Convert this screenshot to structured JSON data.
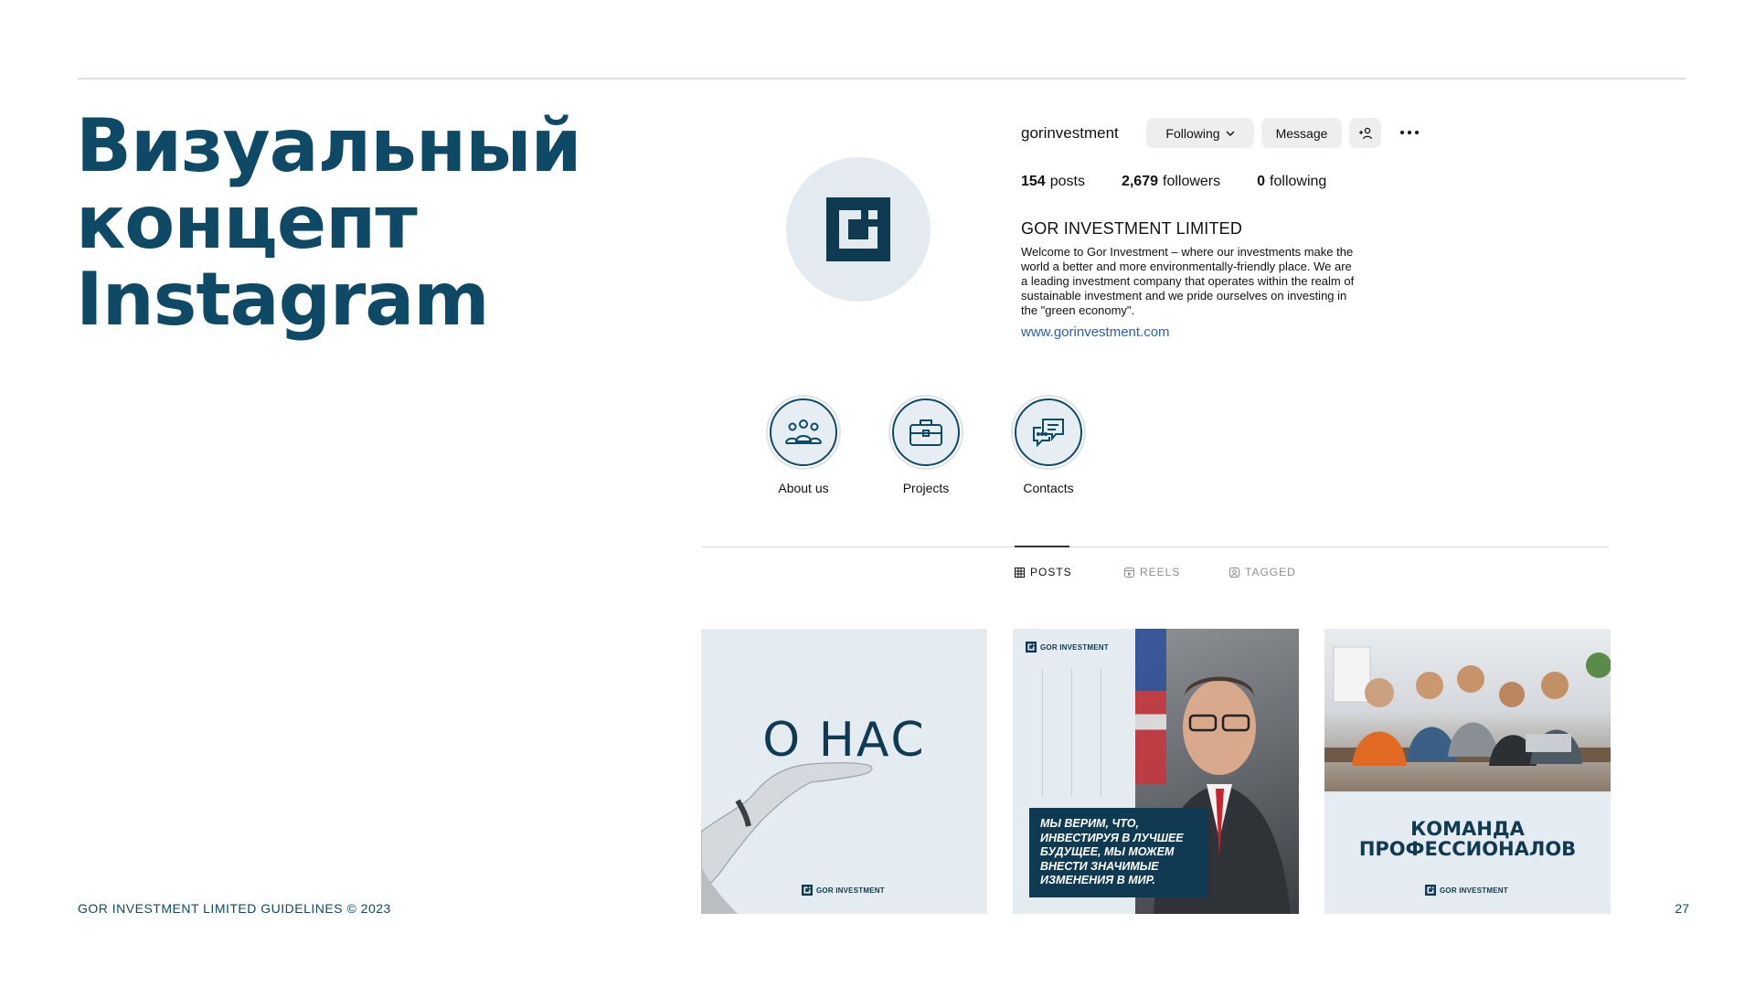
{
  "slide": {
    "title_lines": [
      "Визуальный",
      "концепт",
      "Instagram"
    ],
    "footer": "GOR INVESTMENT LIMITED GUIDELINES © 2023",
    "page_number": "27"
  },
  "profile": {
    "username": "gorinvestment",
    "following_button": "Following",
    "message_button": "Message",
    "stats": {
      "posts_count": "154",
      "posts_label": "posts",
      "followers_count": "2,679",
      "followers_label": "followers",
      "following_count": "0",
      "following_label": "following"
    },
    "name": "GOR INVESTMENT LIMITED",
    "bio": "Welcome to Gor Investment – where our investments make the world a better and more environmentally-friendly place. We are a leading investment company that operates within the realm of sustainable investment and we pride ourselves on investing in the \"green economy\".",
    "link": "www.gorinvestment.com"
  },
  "highlights": [
    {
      "label": "About us",
      "icon": "people-group-icon"
    },
    {
      "label": "Projects",
      "icon": "briefcase-icon"
    },
    {
      "label": "Contacts",
      "icon": "chat-bubbles-icon"
    }
  ],
  "tabs": [
    {
      "label": "POSTS",
      "icon": "grid-icon",
      "active": true
    },
    {
      "label": "REELS",
      "icon": "reels-icon",
      "active": false
    },
    {
      "label": "TAGGED",
      "icon": "tagged-icon",
      "active": false
    }
  ],
  "posts": {
    "post1": {
      "title": "О НАС",
      "logo_text": "GOR INVESTMENT"
    },
    "post2": {
      "logo_text": "GOR INVESTMENT",
      "quote": "МЫ ВЕРИМ, ЧТО, ИНВЕСТИРУЯ В ЛУЧШЕЕ БУДУЩЕЕ, МЫ МОЖЕМ ВНЕСТИ ЗНАЧИМЫЕ ИЗМЕНЕНИЯ В МИР."
    },
    "post3": {
      "title_lines": [
        "КОМАНДА",
        "ПРОФЕССИОНАЛОВ"
      ],
      "logo_text": "GOR INVESTMENT"
    }
  },
  "colors": {
    "brand_dark": "#0e4a66",
    "brand_navy": "#0f3a52",
    "tile_bg": "#e4ebf1",
    "link": "#2b5fb8"
  }
}
